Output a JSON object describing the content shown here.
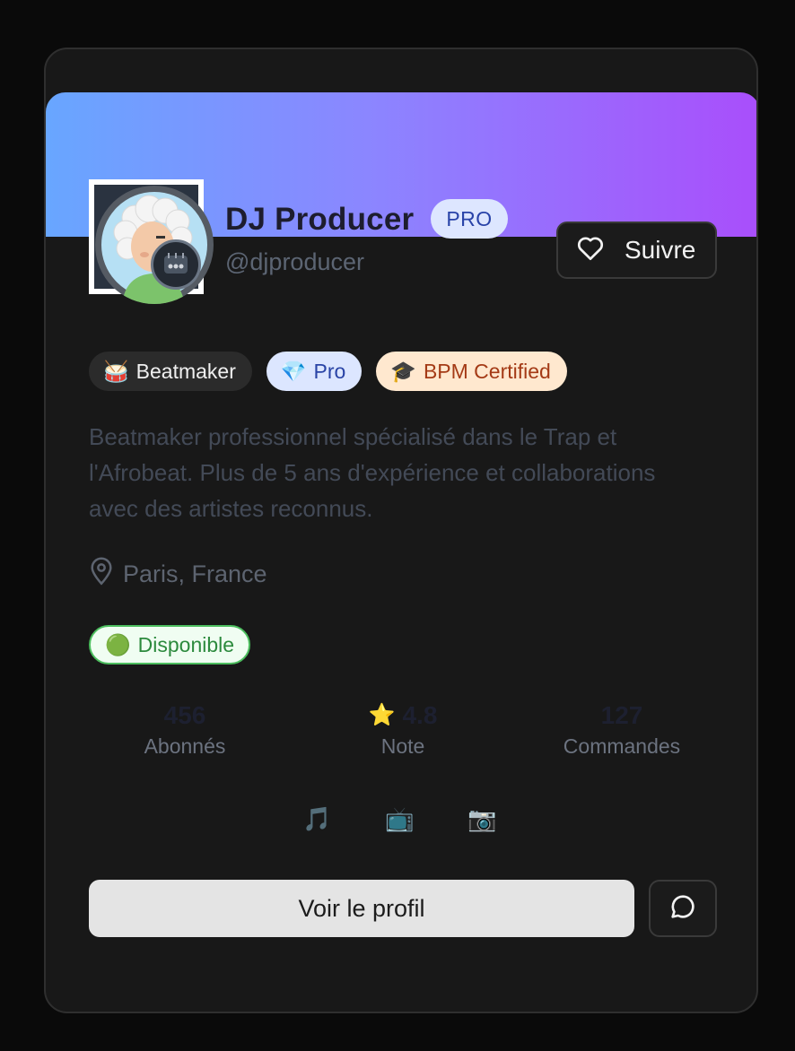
{
  "profile": {
    "name": "DJ Producer",
    "badge": "PRO",
    "handle": "@djproducer",
    "follow_label": "Suivre"
  },
  "tags": [
    {
      "icon": "🥁",
      "label": "Beatmaker"
    },
    {
      "icon": "💎",
      "label": "Pro"
    },
    {
      "icon": "🎓",
      "label": "BPM Certified"
    }
  ],
  "bio": "Beatmaker professionnel spécialisé dans le Trap et l'Afrobeat. Plus de 5 ans d'expérience et collaborations avec des artistes reconnus.",
  "location": "Paris, France",
  "status": {
    "icon": "🟢",
    "label": "Disponible"
  },
  "stats": [
    {
      "value": "456",
      "label": "Abonnés"
    },
    {
      "icon": "⭐",
      "value": "4.8",
      "label": "Note"
    },
    {
      "value": "127",
      "label": "Commandes"
    }
  ],
  "socials": [
    {
      "icon": "🎵",
      "name": "music-icon"
    },
    {
      "icon": "📺",
      "name": "tv-icon"
    },
    {
      "icon": "📷",
      "name": "camera-icon"
    }
  ],
  "actions": {
    "view_profile": "Voir le profil"
  },
  "colors": {
    "banner_start": "#68a6ff",
    "banner_end": "#a94efb",
    "pro_badge_bg": "#dde6ff",
    "available_green": "#4cbe5e"
  }
}
